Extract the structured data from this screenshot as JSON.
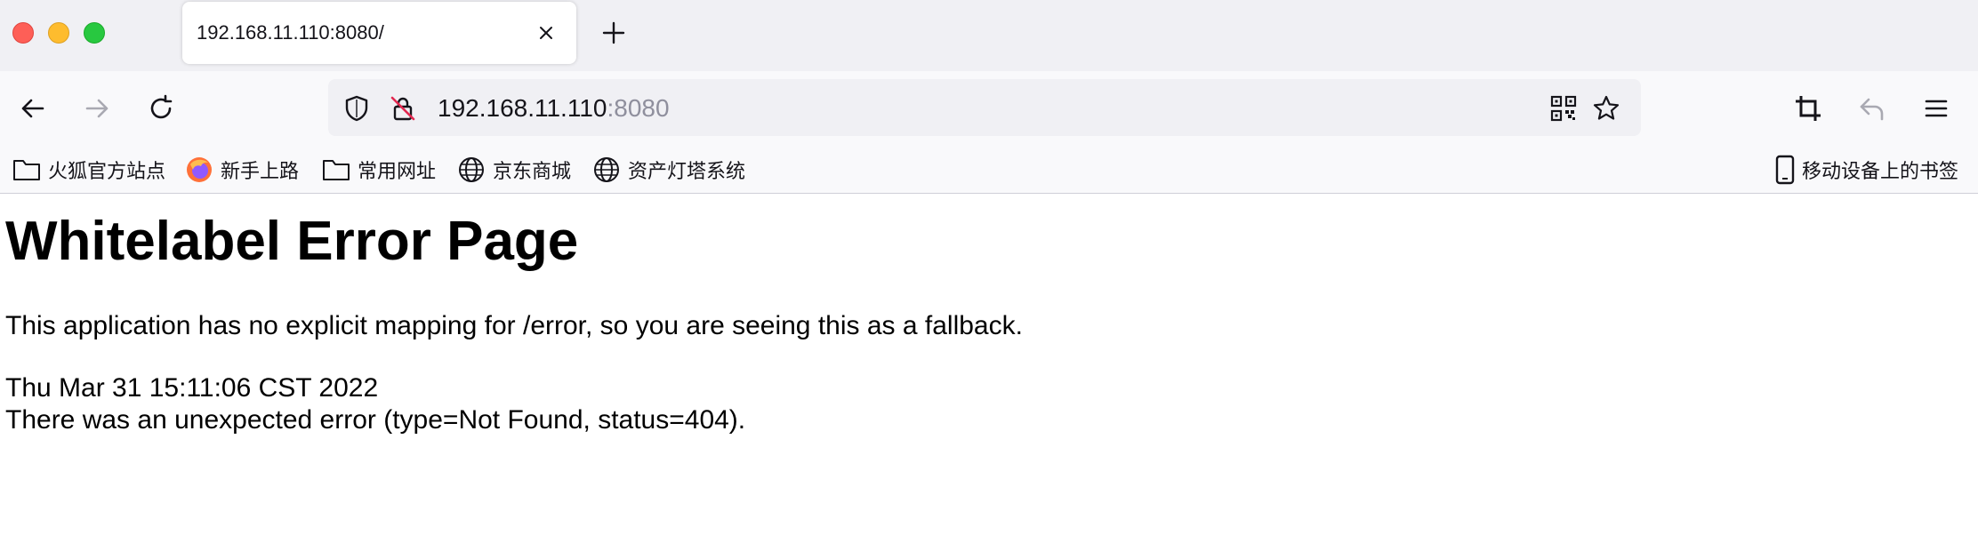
{
  "tab": {
    "title": "192.168.11.110:8080/"
  },
  "urlbar": {
    "host": "192.168.11.110",
    "port": ":8080"
  },
  "icons": {
    "back": "arrow-left-icon",
    "forward": "arrow-right-icon",
    "reload": "reload-icon",
    "shield": "tracking-protection-shield-icon",
    "insecure": "insecure-lock-icon",
    "qr": "qr-code-icon",
    "star": "bookmark-star-icon",
    "screenshot": "crop-screenshot-icon",
    "undo": "undo-icon",
    "menu": "hamburger-menu-icon"
  },
  "bookmarks": [
    {
      "label": "火狐官方站点",
      "icon": "folder-icon"
    },
    {
      "label": "新手上路",
      "icon": "firefox-icon"
    },
    {
      "label": "常用网址",
      "icon": "folder-icon"
    },
    {
      "label": "京东商城",
      "icon": "globe-icon"
    },
    {
      "label": "资产灯塔系统",
      "icon": "globe-icon"
    }
  ],
  "mobile_bookmarks": "移动设备上的书签",
  "page": {
    "heading": "Whitelabel Error Page",
    "explanation": "This application has no explicit mapping for /error, so you are seeing this as a fallback.",
    "timestamp": "Thu Mar 31 15:11:06 CST 2022",
    "error": "There was an unexpected error (type=Not Found, status=404)."
  },
  "colors": {
    "traffic_close": "#fe5f57",
    "traffic_min": "#febc2e",
    "traffic_max": "#28c840",
    "toolbar_bg": "#f9f9fb",
    "tabstrip_bg": "#f0f0f4"
  }
}
